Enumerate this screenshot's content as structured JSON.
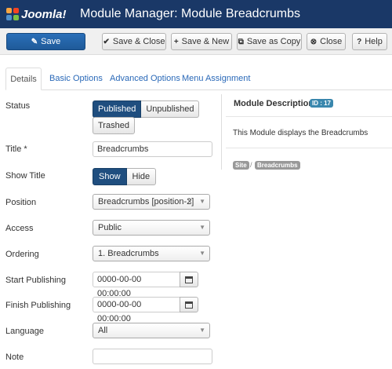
{
  "header": {
    "logo_text": "Joomla!",
    "title": "Module Manager: Module Breadcrumbs"
  },
  "toolbar": {
    "save": "Save",
    "save_close": "Save & Close",
    "save_new": "Save & New",
    "save_copy": "Save as Copy",
    "close": "Close",
    "help": "Help"
  },
  "tabs": [
    "Details",
    "Basic Options",
    "Advanced Options",
    "Menu Assignment"
  ],
  "form": {
    "status": {
      "label": "Status",
      "options": [
        "Published",
        "Unpublished",
        "Trashed"
      ],
      "selected": "Published"
    },
    "title": {
      "label": "Title *",
      "value": "Breadcrumbs"
    },
    "show_title": {
      "label": "Show Title",
      "options": [
        "Show",
        "Hide"
      ],
      "selected": "Show"
    },
    "position": {
      "label": "Position",
      "value": "Breadcrumbs [position-2]"
    },
    "access": {
      "label": "Access",
      "value": "Public"
    },
    "ordering": {
      "label": "Ordering",
      "value": "1. Breadcrumbs"
    },
    "start_publishing": {
      "label": "Start Publishing",
      "value": "0000-00-00 00:00:00"
    },
    "finish_publishing": {
      "label": "Finish Publishing",
      "value": "0000-00-00 00:00:00"
    },
    "language": {
      "label": "Language",
      "value": "All"
    },
    "note": {
      "label": "Note",
      "value": ""
    }
  },
  "description": {
    "title": "Module Description",
    "id_badge": "ID : 17",
    "text": "This Module displays the Breadcrumbs",
    "tags": [
      "Site",
      "Breadcrumbs"
    ]
  },
  "colors": {
    "header_bg": "#1a3867",
    "primary": "#2a6fb8",
    "toggle_active": "#1f4e7f",
    "link": "#2a69b8"
  }
}
